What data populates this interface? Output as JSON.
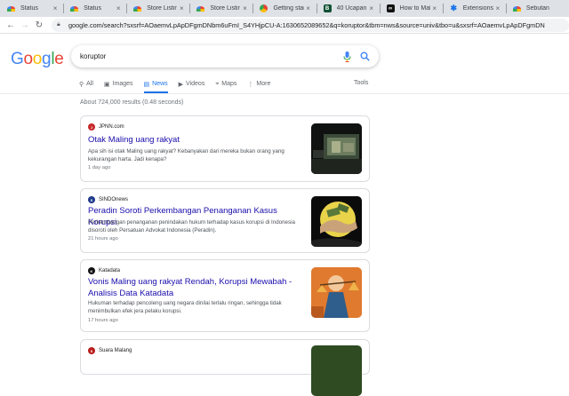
{
  "browser": {
    "tabs": [
      {
        "title": "Status",
        "icon": "rainbow-favicon-icon",
        "favclass": "rainbow",
        "glyph": ""
      },
      {
        "title": "Status",
        "icon": "rainbow-favicon-icon",
        "favclass": "rainbow",
        "glyph": ""
      },
      {
        "title": "Store Listing",
        "icon": "rainbow-favicon-icon",
        "favclass": "rainbow",
        "glyph": ""
      },
      {
        "title": "Store Listing",
        "icon": "rainbow-favicon-icon",
        "favclass": "rainbow",
        "glyph": ""
      },
      {
        "title": "Getting start",
        "icon": "chrome-favicon-icon",
        "favclass": "chrome",
        "glyph": ""
      },
      {
        "title": "40 Ucapan Id",
        "icon": "b-favicon-icon",
        "favclass": "green",
        "glyph": "B"
      },
      {
        "title": "How to Mak",
        "icon": "infinity-favicon-icon",
        "favclass": "black",
        "glyph": "∞"
      },
      {
        "title": "Extensions",
        "icon": "puzzle-favicon-icon",
        "favclass": "blue",
        "glyph": "✱"
      },
      {
        "title": "Sebutan",
        "icon": "rainbow-favicon-icon",
        "favclass": "rainbow",
        "glyph": ""
      }
    ],
    "url": "google.com/search?sxsrf=AOaemvLpApDFgmDNbm6uFmI_S4YHjpCU-A:1630652089652&q=koruptor&tbm=nws&source=univ&tbo=u&sxsrf=AOaemvLpApDFgmDN"
  },
  "google": {
    "logo_letters": [
      "G",
      "o",
      "o",
      "g",
      "l",
      "e"
    ],
    "logo_colors": [
      "#4285f4",
      "#ea4335",
      "#fbbc05",
      "#4285f4",
      "#34a853",
      "#ea4335"
    ],
    "query": "koruptor",
    "tabs": [
      {
        "label": "All",
        "icon": "search-icon",
        "glyph": "⚲"
      },
      {
        "label": "Images",
        "icon": "image-icon",
        "glyph": "▣"
      },
      {
        "label": "News",
        "icon": "news-icon",
        "glyph": "▤",
        "active": true
      },
      {
        "label": "Videos",
        "icon": "video-icon",
        "glyph": "▶"
      },
      {
        "label": "Maps",
        "icon": "map-pin-icon",
        "glyph": "⌖"
      },
      {
        "label": "More",
        "icon": "more-icon",
        "glyph": "⋮"
      }
    ],
    "tools_label": "Tools",
    "stats": "About 724,000 results (0.48 seconds)"
  },
  "results": [
    {
      "source": "JPNN.com",
      "headline": "Otak Maling uang rakyat",
      "snippet": "Apa sih isi otak Maling uang rakyat? Kebanyakan dari mereka bukan orang yang kekurangan harta. Jadi kenapa?",
      "time": "1 day ago",
      "fav_color": "#c62828"
    },
    {
      "source": "SINDOnews",
      "headline": "Peradin Soroti Perkembangan Penanganan Kasus Korupsi",
      "snippet": "Perkembangan penanganan penindakan hukum terhadap kasus korupsi di Indonesia disoroti oleh Persatuan Advokat Indonesia (Peradin).",
      "time": "21 hours ago",
      "fav_color": "#1e3a8a"
    },
    {
      "source": "Katadata",
      "headline": "Vonis Maling uang rakyat Rendah, Korupsi Mewabah - Analisis Data Katadata",
      "snippet": "Hukuman terhadap pencoleng uang negara dinilai terlalu ringan, sehingga tidak menimbulkan efek jera pelaku korupsi.",
      "time": "17 hours ago",
      "fav_color": "#111111"
    },
    {
      "source": "Suara Malang",
      "headline": "",
      "snippet": "",
      "time": "",
      "fav_color": "#b91c1c"
    }
  ]
}
